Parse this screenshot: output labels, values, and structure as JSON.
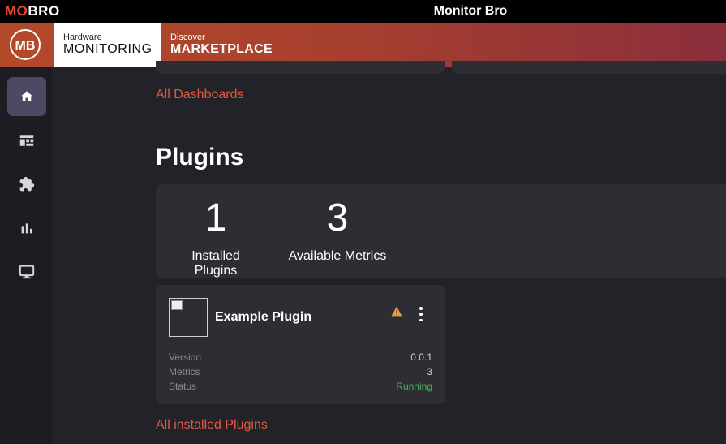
{
  "titlebar": {
    "brand_mo": "MO",
    "brand_bro": "BRO",
    "title": "Monitor Bro"
  },
  "topbar": {
    "logo_text": "MB",
    "nav": [
      {
        "small": "Hardware",
        "big": "MONITORING",
        "active": true
      },
      {
        "small": "Discover",
        "big": "MARKETPLACE",
        "active": false
      }
    ]
  },
  "sidebar": {
    "items": [
      {
        "icon": "home-icon",
        "active": true
      },
      {
        "icon": "dashboard-icon",
        "active": false
      },
      {
        "icon": "puzzle-icon",
        "active": false
      },
      {
        "icon": "bar-chart-icon",
        "active": false
      },
      {
        "icon": "monitor-icon",
        "active": false
      }
    ]
  },
  "main": {
    "all_dashboards_link": "All Dashboards",
    "plugins_title": "Plugins",
    "stats": [
      {
        "value": "1",
        "label": "Installed Plugins"
      },
      {
        "value": "3",
        "label": "Available Metrics"
      }
    ],
    "plugin": {
      "name": "Example Plugin",
      "rows": [
        {
          "label": "Version",
          "value": "0.0.1"
        },
        {
          "label": "Metrics",
          "value": "3"
        },
        {
          "label": "Status",
          "value": "Running"
        }
      ]
    },
    "all_plugins_link": "All installed Plugins"
  },
  "colors": {
    "accent": "#e05a40",
    "status_running": "#3fb75c",
    "warning": "#f0a030"
  }
}
